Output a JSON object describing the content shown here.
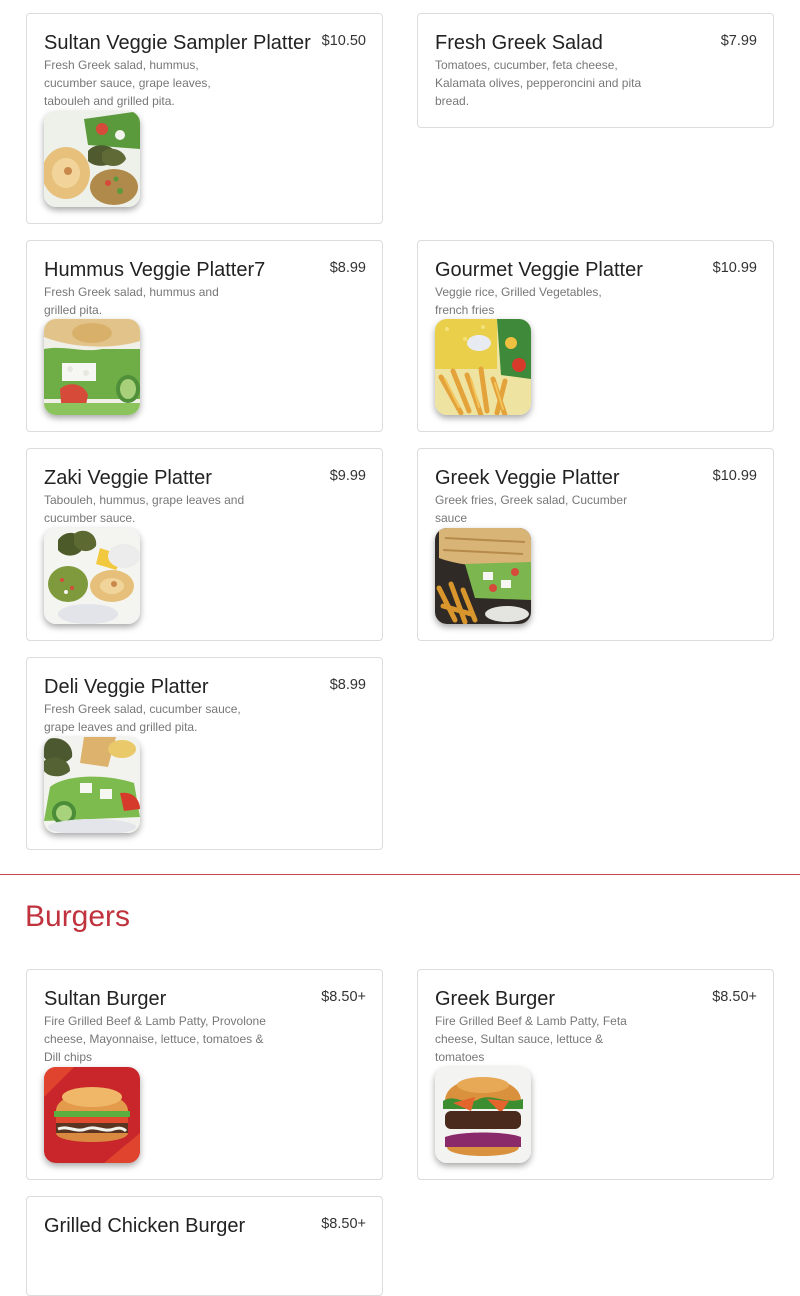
{
  "veggie_items": [
    {
      "name": "Sultan Veggie Sampler Platter",
      "price": "$10.50",
      "description": "Fresh Greek salad, hummus, cucumber sauce, grape leaves, tabouleh and grilled pita.",
      "image_icon": "veggie-sampler-photo"
    },
    {
      "name": "Fresh Greek Salad",
      "price": "$7.99",
      "description": "Tomatoes, cucumber, feta cheese, Kalamata olives, pepperoncini and pita bread.",
      "image_icon": ""
    },
    {
      "name": "Hummus Veggie Platter7",
      "price": "$8.99",
      "description": "Fresh Greek salad, hummus and grilled pita.",
      "image_icon": "hummus-platter-photo"
    },
    {
      "name": "Gourmet Veggie Platter",
      "price": "$10.99",
      "description": "Veggie rice, Grilled Vegetables, french fries",
      "image_icon": "gourmet-platter-photo"
    },
    {
      "name": "Zaki Veggie Platter",
      "price": "$9.99",
      "description": "Tabouleh, hummus, grape leaves and cucumber sauce.",
      "image_icon": "zaki-platter-photo"
    },
    {
      "name": "Greek Veggie Platter",
      "price": "$10.99",
      "description": "Greek fries, Greek salad, Cucumber sauce",
      "image_icon": "greek-platter-photo"
    },
    {
      "name": "Deli Veggie Platter",
      "price": "$8.99",
      "description": "Fresh Greek salad, cucumber sauce, grape leaves and grilled pita.",
      "image_icon": "deli-platter-photo"
    }
  ],
  "burgers": {
    "title": "Burgers",
    "items": [
      {
        "name": "Sultan Burger",
        "price": "$8.50+",
        "description": "Fire Grilled Beef & Lamb Patty, Provolone cheese, Mayonnaise, lettuce, tomatoes & Dill chips",
        "image_icon": "sultan-burger-photo"
      },
      {
        "name": "Greek Burger",
        "price": "$8.50+",
        "description": "Fire Grilled Beef & Lamb Patty, Feta cheese, Sultan sauce, lettuce & tomatoes",
        "image_icon": "greek-burger-photo"
      },
      {
        "name": "Grilled Chicken Burger",
        "price": "$8.50+",
        "description": "",
        "image_icon": ""
      }
    ]
  },
  "colors": {
    "accent": "#c0323d",
    "divider": "#c8434d",
    "card_border": "#dcdcdc"
  }
}
